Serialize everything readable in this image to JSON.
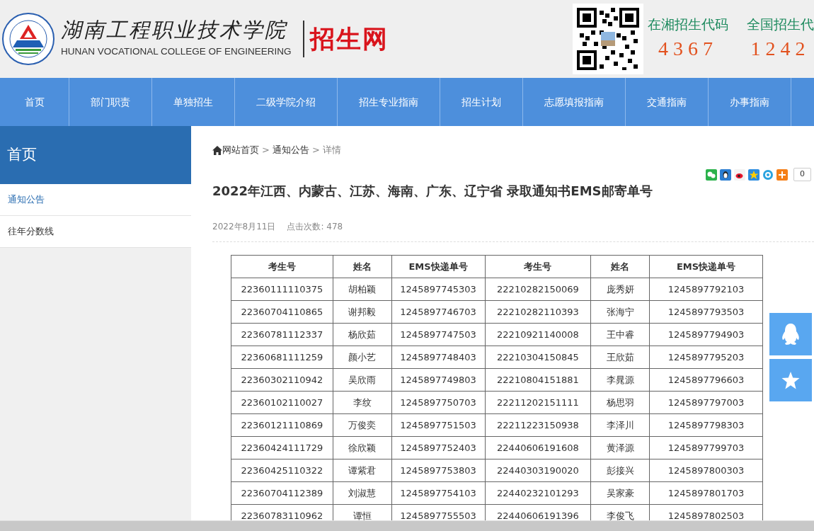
{
  "header": {
    "school_name": "湖南工程职业技术学院",
    "school_name_en": "HUNAN VOCATIONAL COLLEGE OF ENGINEERING",
    "site_name": "招生网",
    "codes": [
      {
        "label": "在湘招生代码",
        "code": "4367"
      },
      {
        "label": "全国招生代",
        "code": "1242"
      }
    ]
  },
  "nav": [
    {
      "label": "首页",
      "selected": false
    },
    {
      "label": "部门职责",
      "selected": false
    },
    {
      "label": "单独招生",
      "selected": false
    },
    {
      "label": "二级学院介绍",
      "selected": false
    },
    {
      "label": "招生专业指南",
      "selected": false
    },
    {
      "label": "招生计划",
      "selected": false
    },
    {
      "label": "志愿填报指南",
      "selected": false
    },
    {
      "label": "交通指南",
      "selected": false
    },
    {
      "label": "办事指南",
      "selected": false
    }
  ],
  "sidebar": {
    "title": "首页",
    "items": [
      {
        "label": "通知公告",
        "selected": true
      },
      {
        "label": "往年分数线",
        "selected": false
      }
    ]
  },
  "breadcrumb": [
    {
      "kind": "link",
      "text": "网站首页"
    },
    {
      "kind": "sep",
      "text": ">"
    },
    {
      "kind": "link",
      "text": "通知公告"
    },
    {
      "kind": "sep",
      "text": ">"
    },
    {
      "kind": "current",
      "text": "详情"
    }
  ],
  "share": {
    "count": "0"
  },
  "article": {
    "title": "2022年江西、内蒙古、江苏、海南、广东、辽宁省 录取通知书EMS邮寄单号",
    "date": "2022年8月11日",
    "views": "点击次数: 478"
  },
  "table": {
    "columns": [
      "考生号",
      "姓名",
      "EMS快递单号",
      "考生号",
      "姓名",
      "EMS快递单号"
    ],
    "rows": [
      [
        "22360111110375",
        "胡柏颖",
        "1245897745303",
        "22210282150069",
        "庞秀妍",
        "1245897792103"
      ],
      [
        "22360704110865",
        "谢邦毅",
        "1245897746703",
        "22210282110393",
        "张海宁",
        "1245897793503"
      ],
      [
        "22360781112337",
        "杨欣茹",
        "1245897747503",
        "22210921140008",
        "王中睿",
        "1245897794903"
      ],
      [
        "22360681111259",
        "颜小艺",
        "1245897748403",
        "22210304150845",
        "王欣茹",
        "1245897795203"
      ],
      [
        "22360302110942",
        "吴欣雨",
        "1245897749803",
        "22210804151881",
        "李晁源",
        "1245897796603"
      ],
      [
        "22360102110027",
        "李纹",
        "1245897750703",
        "22211202151111",
        "杨思羽",
        "1245897797003"
      ],
      [
        "22360121110869",
        "万俊奕",
        "1245897751503",
        "22211223150938",
        "李泽川",
        "1245897798303"
      ],
      [
        "22360424111729",
        "徐欣颖",
        "1245897752403",
        "22440606191608",
        "黄泽源",
        "1245897799703"
      ],
      [
        "22360425110322",
        "谭紫君",
        "1245897753803",
        "22440303190020",
        "彭接兴",
        "1245897800303"
      ],
      [
        "22360704112389",
        "刘淑慧",
        "1245897754103",
        "22440232101293",
        "吴家豪",
        "1245897801703"
      ],
      [
        "22360783110962",
        "谭恒",
        "1245897755503",
        "22440606191396",
        "李俊飞",
        "1245897802503"
      ]
    ]
  }
}
